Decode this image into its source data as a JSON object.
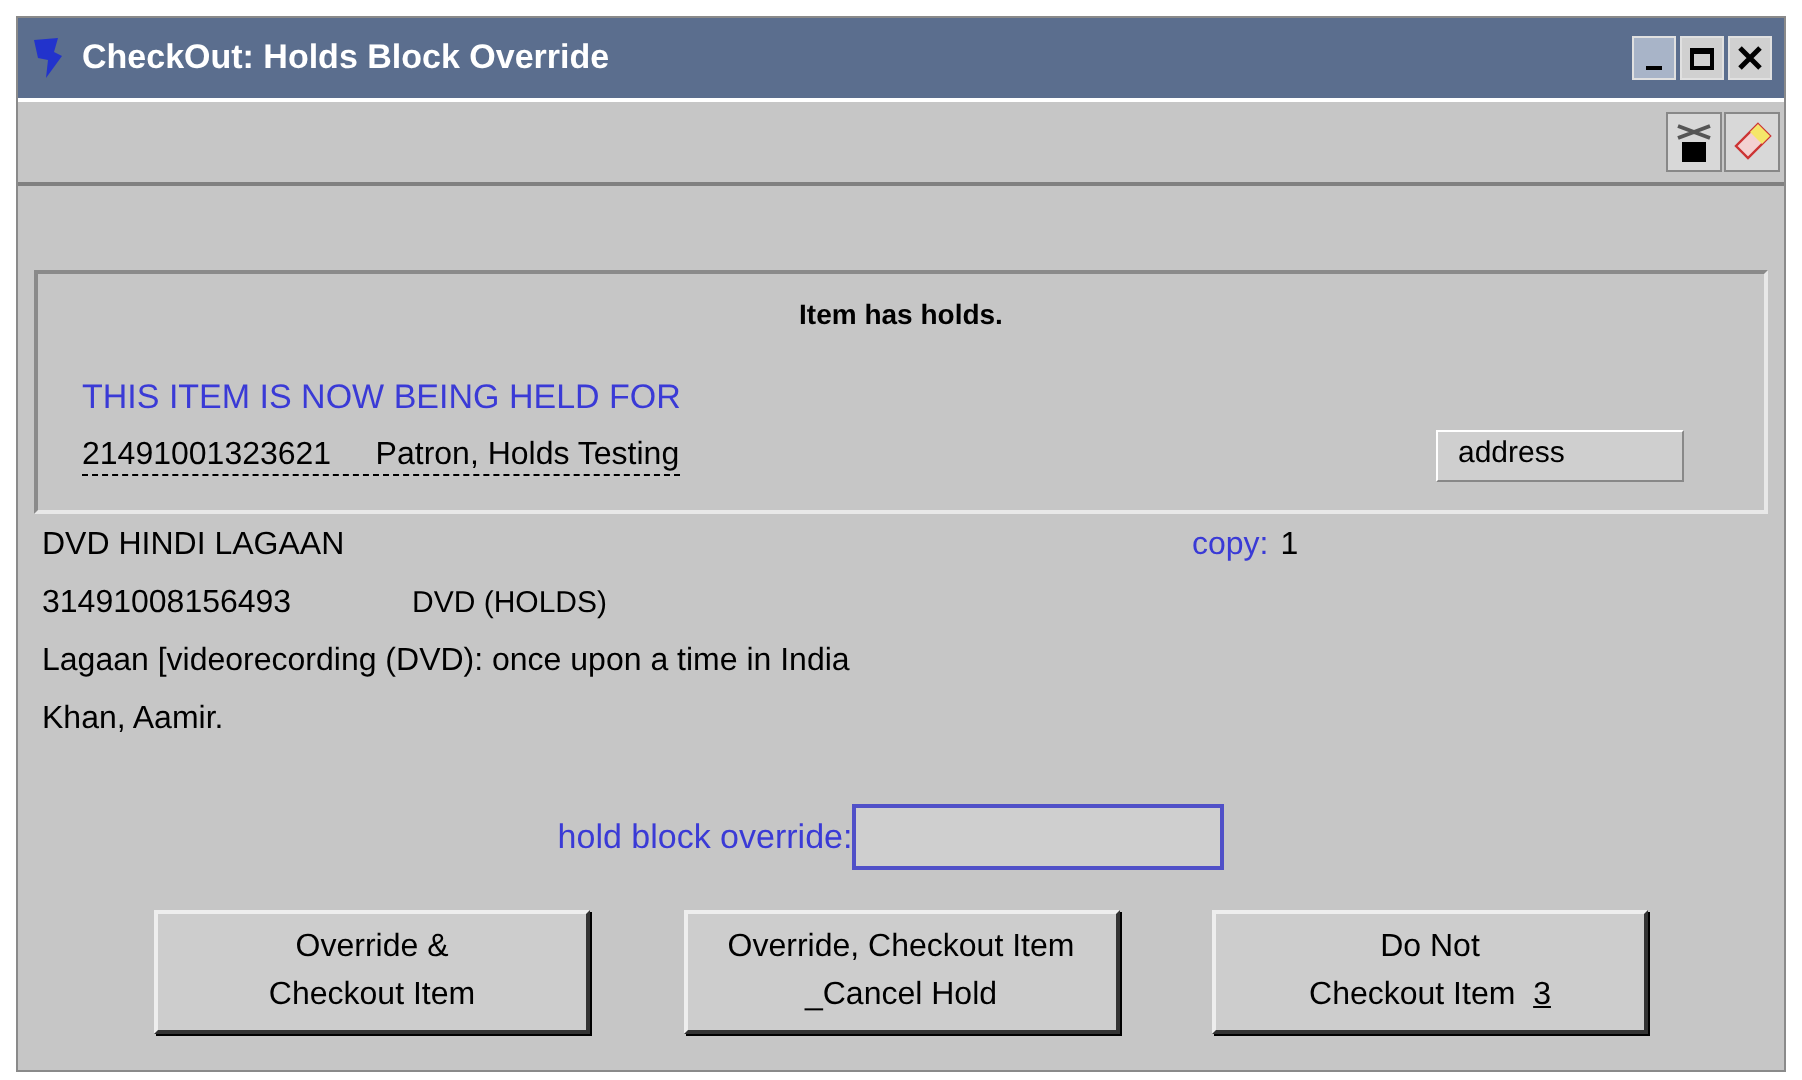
{
  "window": {
    "title": "CheckOut: Holds Block Override"
  },
  "message": {
    "heading": "Item has holds.",
    "notice": "THIS ITEM IS NOW BEING HELD FOR",
    "patron": "21491001323621     Patron, Holds Testing",
    "address_button": "address"
  },
  "item": {
    "title": "DVD HINDI LAGAAN",
    "copy_label": "copy:",
    "copy_value": "1",
    "barcode": "31491008156493",
    "type": "DVD (HOLDS)",
    "description": "Lagaan [videorecording (DVD): once upon a time in India",
    "author": "Khan, Aamir."
  },
  "override_field": {
    "label": "hold block override:"
  },
  "buttons": [
    {
      "lines": [
        "Override &",
        "Checkout Item"
      ]
    },
    {
      "lines": [
        "Override, Checkout Item",
        "_Cancel Hold"
      ]
    },
    {
      "lines": [
        "Do Not",
        "Checkout Item"
      ],
      "shortcut": "3"
    }
  ]
}
